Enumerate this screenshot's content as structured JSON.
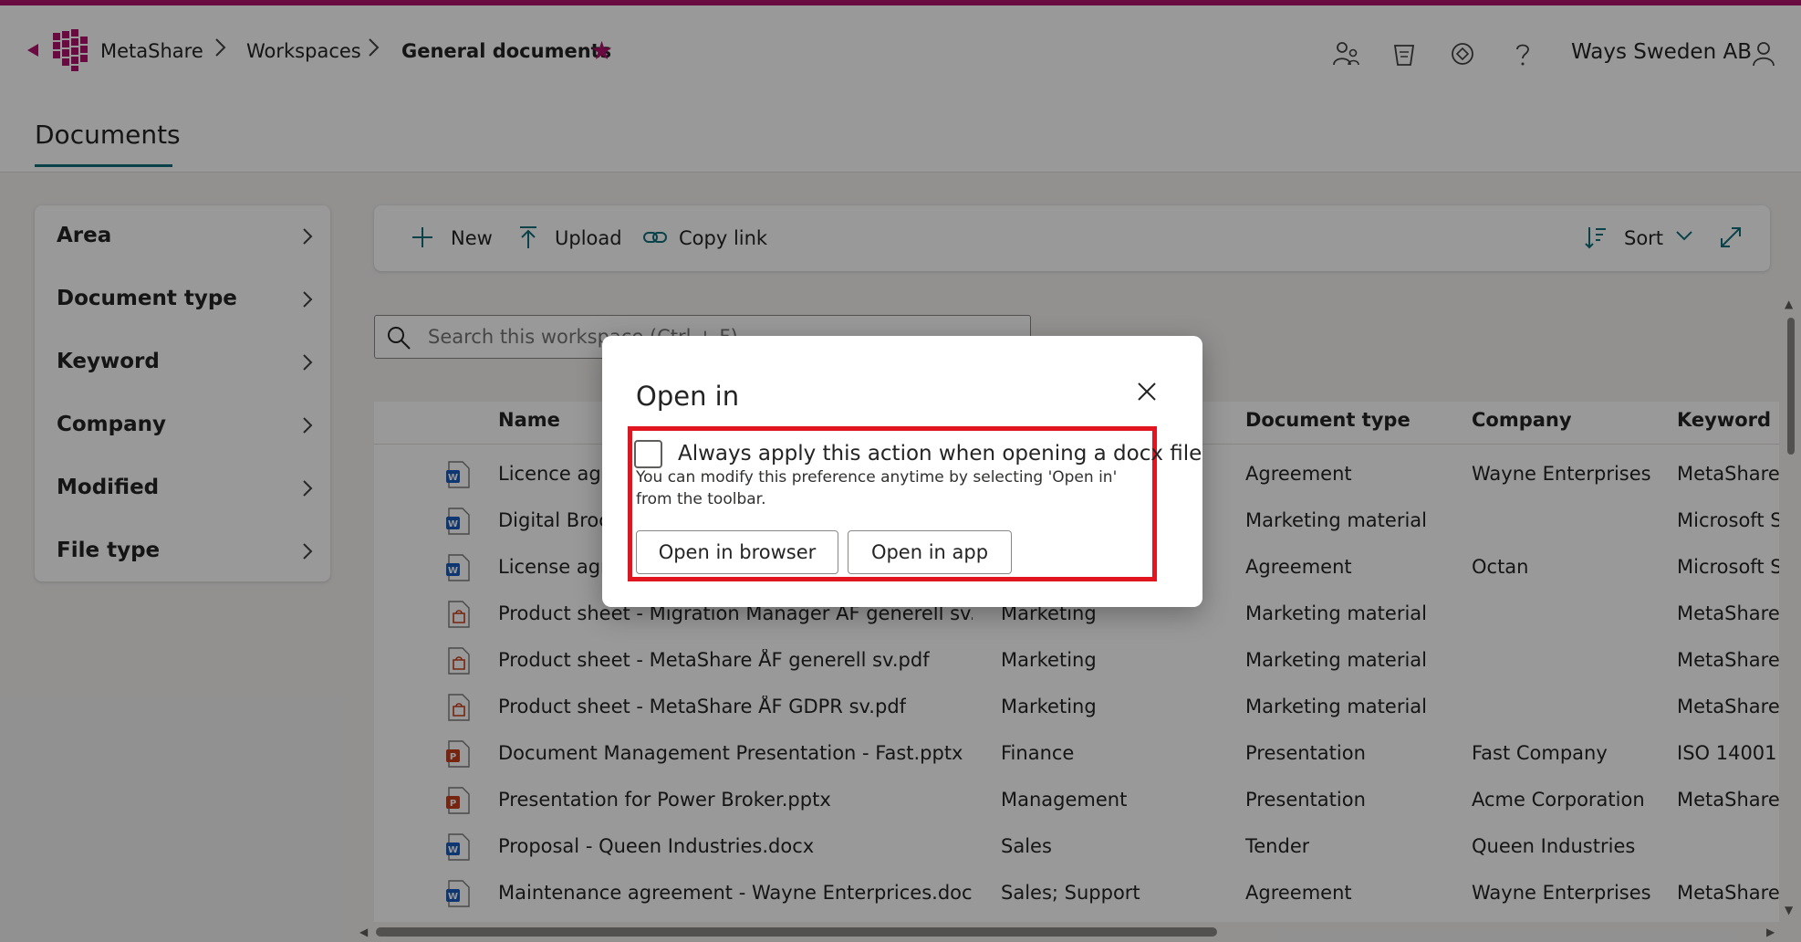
{
  "header": {
    "breadcrumb": [
      "MetaShare",
      "Workspaces",
      "General documents"
    ],
    "org_name": "Ways Sweden AB"
  },
  "page": {
    "tab": "Documents"
  },
  "filters": [
    "Area",
    "Document type",
    "Keyword",
    "Company",
    "Modified",
    "File type"
  ],
  "toolbar": {
    "new": "New",
    "upload": "Upload",
    "copy_link": "Copy link",
    "sort": "Sort"
  },
  "search": {
    "placeholder": "Search this workspace (Ctrl + F)"
  },
  "grid": {
    "columns": [
      "Name",
      "Document type",
      "Company",
      "Keyword"
    ],
    "rows": [
      {
        "icon": "word-file-icon",
        "name": "Licence agre",
        "area": "",
        "doctype": "Agreement",
        "company": "Wayne Enterprises",
        "keyword": "MetaShare C"
      },
      {
        "icon": "word-file-icon",
        "name": "Digital Broch",
        "area": "",
        "doctype": "Marketing material",
        "company": "",
        "keyword": "Microsoft Sh"
      },
      {
        "icon": "word-file-icon",
        "name": "License agre",
        "area": "",
        "doctype": "Agreement",
        "company": "Octan",
        "keyword": "Microsoft Sh"
      },
      {
        "icon": "pdf-file-icon",
        "name": "Product sheet - Migration Manager ÅF generell sv.pdf",
        "area": "Marketing",
        "doctype": "Marketing material",
        "company": "",
        "keyword": "MetaShare C"
      },
      {
        "icon": "pdf-file-icon",
        "name": "Product sheet - MetaShare ÅF generell sv.pdf",
        "area": "Marketing",
        "doctype": "Marketing material",
        "company": "",
        "keyword": "MetaShare C"
      },
      {
        "icon": "pdf-file-icon",
        "name": "Product sheet - MetaShare ÅF GDPR sv.pdf",
        "area": "Marketing",
        "doctype": "Marketing material",
        "company": "",
        "keyword": "MetaShare C"
      },
      {
        "icon": "powerpoint-file-icon",
        "name": "Document Management Presentation - Fast.pptx",
        "area": "Finance",
        "doctype": "Presentation",
        "company": "Fast Company",
        "keyword": "ISO 14001"
      },
      {
        "icon": "powerpoint-file-icon",
        "name": "Presentation for Power Broker.pptx",
        "area": "Management",
        "doctype": "Presentation",
        "company": "Acme Corporation",
        "keyword": "MetaShare C"
      },
      {
        "icon": "word-file-icon",
        "name": "Proposal - Queen Industries.docx",
        "area": "Sales",
        "doctype": "Tender",
        "company": "Queen Industries",
        "keyword": ""
      },
      {
        "icon": "word-file-icon",
        "name": "Maintenance agreement - Wayne Enterprices.docx",
        "area": "Sales; Support",
        "doctype": "Agreement",
        "company": "Wayne Enterprises",
        "keyword": "MetaShare C"
      }
    ]
  },
  "dialog": {
    "title": "Open in",
    "checkbox_label": "Always apply this action when opening a docx file",
    "hint": "You can modify this preference anytime by selecting 'Open in' from the toolbar.",
    "open_browser": "Open in browser",
    "open_app": "Open in app"
  },
  "colors": {
    "accent": "#b0126b",
    "teal": "#0f6f79",
    "highlight": "#e0151f"
  }
}
